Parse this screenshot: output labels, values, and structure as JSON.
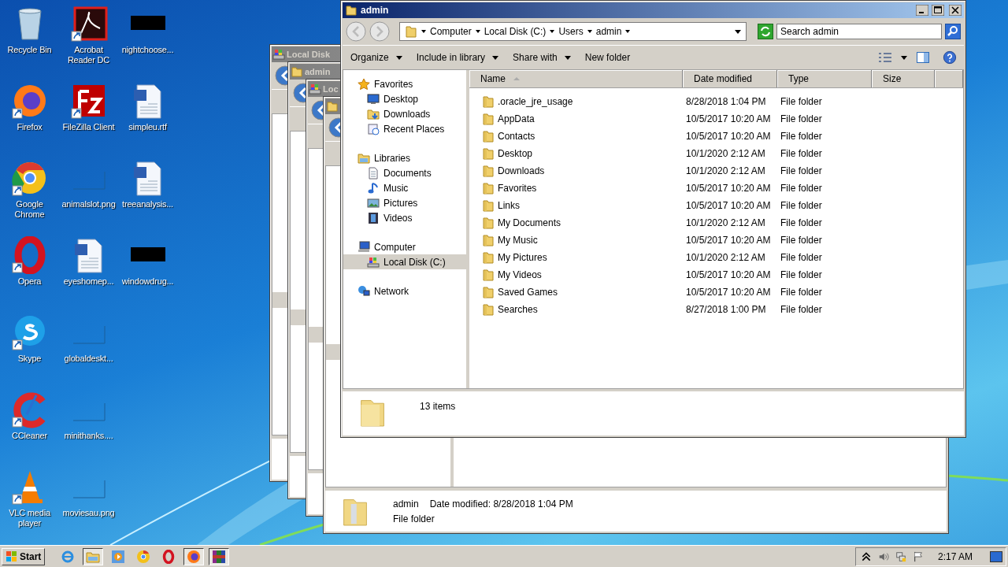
{
  "desktop_icons": [
    {
      "label": "Recycle Bin",
      "kind": "recycle",
      "shortcut": false
    },
    {
      "label": "Firefox",
      "kind": "firefox",
      "shortcut": true
    },
    {
      "label": "Google Chrome",
      "kind": "chrome",
      "shortcut": true
    },
    {
      "label": "Opera",
      "kind": "opera",
      "shortcut": true
    },
    {
      "label": "Skype",
      "kind": "skype",
      "shortcut": true
    },
    {
      "label": "CCleaner",
      "kind": "ccleaner",
      "shortcut": true
    },
    {
      "label": "VLC media player",
      "kind": "vlc",
      "shortcut": true
    },
    {
      "label": "Acrobat Reader DC",
      "kind": "acrobat",
      "shortcut": true
    },
    {
      "label": "FileZilla Client",
      "kind": "filezilla",
      "shortcut": true
    },
    {
      "label": "animalslot.png",
      "kind": "image",
      "shortcut": false
    },
    {
      "label": "eyeshomep...",
      "kind": "word",
      "shortcut": false
    },
    {
      "label": "globaldeskt...",
      "kind": "image",
      "shortcut": false
    },
    {
      "label": "minithanks....",
      "kind": "image",
      "shortcut": false
    },
    {
      "label": "moviesau.png",
      "kind": "image",
      "shortcut": false
    },
    {
      "label": "nightchoose...",
      "kind": "dark",
      "shortcut": false
    },
    {
      "label": "simpleu.rtf",
      "kind": "word",
      "shortcut": false
    },
    {
      "label": "treeanalysis...",
      "kind": "word",
      "shortcut": false
    },
    {
      "label": "windowdrug...",
      "kind": "dark",
      "shortcut": false
    }
  ],
  "background_windows": [
    {
      "title": "Local Disk",
      "kind": "drive"
    },
    {
      "title": "admin",
      "kind": "folder"
    },
    {
      "title": "Loc",
      "kind": "drive"
    },
    {
      "kind": "folder",
      "details": {
        "name": "admin",
        "date": "Date modified: 8/28/2018 1:04 PM",
        "type": "File folder"
      }
    }
  ],
  "window": {
    "title": "admin",
    "breadcrumb": [
      "Computer",
      "Local Disk (C:)",
      "Users",
      "admin"
    ],
    "search": {
      "placeholder": "Search admin"
    },
    "toolbar": [
      {
        "label": "Organize",
        "dropdown": true
      },
      {
        "label": "Include in library",
        "dropdown": true
      },
      {
        "label": "Share with",
        "dropdown": true
      },
      {
        "label": "New folder",
        "dropdown": false
      }
    ],
    "nav": [
      {
        "label": "Favorites",
        "kind": "star",
        "selected": false,
        "children": [
          {
            "label": "Desktop",
            "kind": "desktop",
            "selected": false
          },
          {
            "label": "Downloads",
            "kind": "downloads",
            "selected": false
          },
          {
            "label": "Recent Places",
            "kind": "recent",
            "selected": false
          }
        ]
      },
      {
        "label": "Libraries",
        "kind": "library",
        "selected": false,
        "children": [
          {
            "label": "Documents",
            "kind": "document",
            "selected": false
          },
          {
            "label": "Music",
            "kind": "music",
            "selected": false
          },
          {
            "label": "Pictures",
            "kind": "pictures",
            "selected": false
          },
          {
            "label": "Videos",
            "kind": "videos",
            "selected": false
          }
        ]
      },
      {
        "label": "Computer",
        "kind": "computer",
        "selected": false,
        "children": [
          {
            "label": "Local Disk (C:)",
            "kind": "drive",
            "selected": true
          }
        ]
      },
      {
        "label": "Network",
        "kind": "network",
        "selected": false
      }
    ],
    "columns": [
      {
        "label": "Name",
        "sorted": true
      },
      {
        "label": "Date modified",
        "sorted": false
      },
      {
        "label": "Type",
        "sorted": false
      },
      {
        "label": "Size",
        "sorted": false
      }
    ],
    "rows": [
      {
        "name": ".oracle_jre_usage",
        "date": "8/28/2018 1:04 PM",
        "type": "File folder"
      },
      {
        "name": "AppData",
        "date": "10/5/2017 10:20 AM",
        "type": "File folder"
      },
      {
        "name": "Contacts",
        "date": "10/5/2017 10:20 AM",
        "type": "File folder"
      },
      {
        "name": "Desktop",
        "date": "10/1/2020 2:12 AM",
        "type": "File folder"
      },
      {
        "name": "Downloads",
        "date": "10/1/2020 2:12 AM",
        "type": "File folder"
      },
      {
        "name": "Favorites",
        "date": "10/5/2017 10:20 AM",
        "type": "File folder"
      },
      {
        "name": "Links",
        "date": "10/5/2017 10:20 AM",
        "type": "File folder"
      },
      {
        "name": "My Documents",
        "date": "10/1/2020 2:12 AM",
        "type": "File folder"
      },
      {
        "name": "My Music",
        "date": "10/5/2017 10:20 AM",
        "type": "File folder"
      },
      {
        "name": "My Pictures",
        "date": "10/1/2020 2:12 AM",
        "type": "File folder"
      },
      {
        "name": "My Videos",
        "date": "10/5/2017 10:20 AM",
        "type": "File folder"
      },
      {
        "name": "Saved Games",
        "date": "10/5/2017 10:20 AM",
        "type": "File folder"
      },
      {
        "name": "Searches",
        "date": "8/27/2018 1:00 PM",
        "type": "File folder"
      }
    ],
    "status": "13 items"
  },
  "taskbar": {
    "start": "Start",
    "clock": "2:17 AM",
    "apps": [
      {
        "kind": "ie",
        "selected": false
      },
      {
        "kind": "explorer",
        "selected": true
      },
      {
        "kind": "media",
        "selected": false
      },
      {
        "kind": "chrome",
        "selected": false
      },
      {
        "kind": "opera",
        "selected": false
      },
      {
        "kind": "firefox",
        "selected": true
      },
      {
        "kind": "archive",
        "selected": true
      }
    ]
  }
}
